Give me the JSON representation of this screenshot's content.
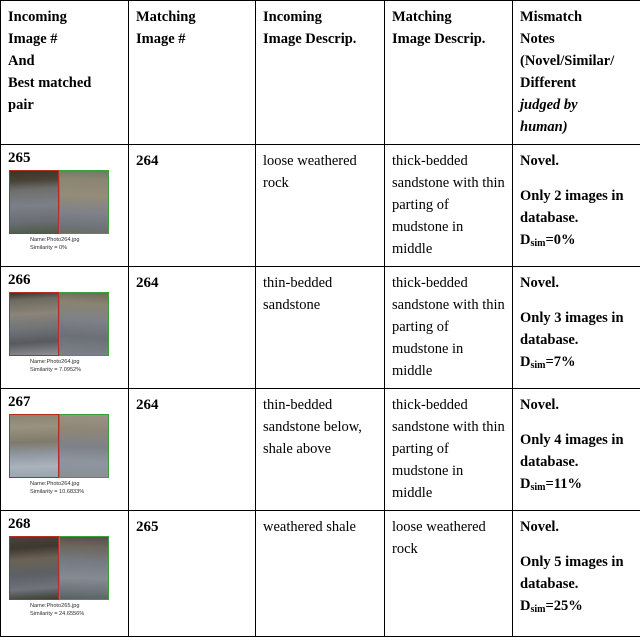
{
  "table": {
    "columns": [
      {
        "id": "incoming-image-number",
        "lines": [
          "Incoming",
          "Image #",
          "And",
          "Best matched",
          "pair"
        ]
      },
      {
        "id": "matching-image-number",
        "lines": [
          "Matching",
          "Image #"
        ]
      },
      {
        "id": "incoming-image-description",
        "lines": [
          "Incoming",
          "Image Descrip."
        ]
      },
      {
        "id": "matching-image-description",
        "lines": [
          "Matching",
          "Image Descrip."
        ]
      },
      {
        "id": "mismatch-notes",
        "lines": [
          "Mismatch",
          "Notes",
          "(Novel/Similar/",
          "Different"
        ],
        "italic_lines": [
          "judged by",
          "human)"
        ]
      }
    ],
    "rows": [
      {
        "incoming_number": "265",
        "thumbnail": {
          "left_border_color": "#b03025",
          "right_border_color": "#3aa03a",
          "caption_name": "Name:Photo264.jpg",
          "caption_similarity": "Similarity = 0%"
        },
        "matching_number": "264",
        "incoming_description": "loose weathered rock",
        "matching_description": "thick-bedded sandstone with thin parting of mudstone in middle",
        "notes": {
          "verdict": "Novel.",
          "detail": "Only 2 images in database.",
          "dsim_label": "D",
          "dsim_sub": "sim",
          "dsim_value": "=0%"
        }
      },
      {
        "incoming_number": "266",
        "thumbnail": {
          "left_border_color": "#b03025",
          "right_border_color": "#3aa03a",
          "caption_name": "Name:Photo264.jpg",
          "caption_similarity": "Similarity = 7.0952%"
        },
        "matching_number": "264",
        "incoming_description": "thin-bedded sandstone",
        "matching_description": "thick-bedded sandstone with thin parting of mudstone in middle",
        "notes": {
          "verdict": "Novel.",
          "detail": "Only 3 images in database.",
          "dsim_label": "D",
          "dsim_sub": "sim",
          "dsim_value": "=7%"
        }
      },
      {
        "incoming_number": "267",
        "thumbnail": {
          "left_border_color": "#b03025",
          "right_border_color": "#3aa03a",
          "caption_name": "Name:Photo264.jpg",
          "caption_similarity": "Similarity = 10.6833%"
        },
        "matching_number": "264",
        "incoming_description": "thin-bedded sandstone below, shale above",
        "matching_description": "thick-bedded sandstone with thin parting of mudstone in middle",
        "notes": {
          "verdict": "Novel.",
          "detail": "Only 4 images in database.",
          "dsim_label": "D",
          "dsim_sub": "sim",
          "dsim_value": "=11%"
        }
      },
      {
        "incoming_number": "268",
        "thumbnail": {
          "left_border_color": "#b03025",
          "right_border_color": "#3aa03a",
          "caption_name": "Name:Photo265.jpg",
          "caption_similarity": "Similarity = 24.6556%"
        },
        "matching_number": "265",
        "incoming_description": "weathered shale",
        "matching_description": "loose weathered rock",
        "notes": {
          "verdict": "Novel.",
          "detail": "Only 5 images in database.",
          "dsim_label": "D",
          "dsim_sub": "sim",
          "dsim_value": "=25%"
        }
      }
    ]
  }
}
